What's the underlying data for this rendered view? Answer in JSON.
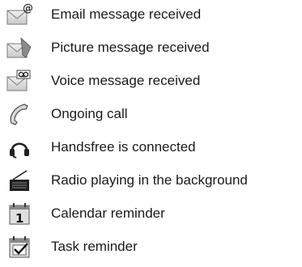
{
  "items": [
    {
      "icon": "email-message-icon",
      "label": "Email message received"
    },
    {
      "icon": "picture-message-icon",
      "label": "Picture message received"
    },
    {
      "icon": "voice-message-icon",
      "label": "Voice message received"
    },
    {
      "icon": "phone-handset-icon",
      "label": "Ongoing call"
    },
    {
      "icon": "headset-icon",
      "label": "Handsfree is connected"
    },
    {
      "icon": "radio-icon",
      "label": "Radio playing in the background"
    },
    {
      "icon": "calendar-icon",
      "label": "Calendar reminder"
    },
    {
      "icon": "task-icon",
      "label": "Task reminder"
    }
  ]
}
